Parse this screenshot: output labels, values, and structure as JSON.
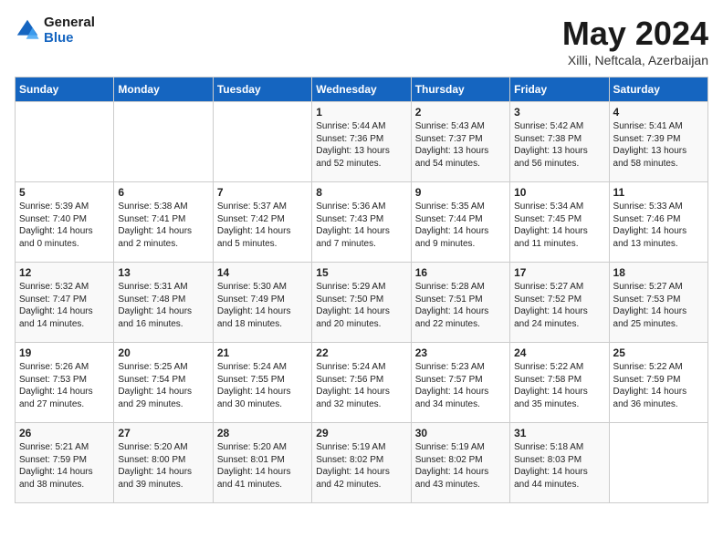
{
  "logo": {
    "line1": "General",
    "line2": "Blue"
  },
  "title": "May 2024",
  "location": "Xilli, Neftcala, Azerbaijan",
  "days_of_week": [
    "Sunday",
    "Monday",
    "Tuesday",
    "Wednesday",
    "Thursday",
    "Friday",
    "Saturday"
  ],
  "weeks": [
    [
      {
        "day": "",
        "detail": ""
      },
      {
        "day": "",
        "detail": ""
      },
      {
        "day": "",
        "detail": ""
      },
      {
        "day": "1",
        "detail": "Sunrise: 5:44 AM\nSunset: 7:36 PM\nDaylight: 13 hours\nand 52 minutes."
      },
      {
        "day": "2",
        "detail": "Sunrise: 5:43 AM\nSunset: 7:37 PM\nDaylight: 13 hours\nand 54 minutes."
      },
      {
        "day": "3",
        "detail": "Sunrise: 5:42 AM\nSunset: 7:38 PM\nDaylight: 13 hours\nand 56 minutes."
      },
      {
        "day": "4",
        "detail": "Sunrise: 5:41 AM\nSunset: 7:39 PM\nDaylight: 13 hours\nand 58 minutes."
      }
    ],
    [
      {
        "day": "5",
        "detail": "Sunrise: 5:39 AM\nSunset: 7:40 PM\nDaylight: 14 hours\nand 0 minutes."
      },
      {
        "day": "6",
        "detail": "Sunrise: 5:38 AM\nSunset: 7:41 PM\nDaylight: 14 hours\nand 2 minutes."
      },
      {
        "day": "7",
        "detail": "Sunrise: 5:37 AM\nSunset: 7:42 PM\nDaylight: 14 hours\nand 5 minutes."
      },
      {
        "day": "8",
        "detail": "Sunrise: 5:36 AM\nSunset: 7:43 PM\nDaylight: 14 hours\nand 7 minutes."
      },
      {
        "day": "9",
        "detail": "Sunrise: 5:35 AM\nSunset: 7:44 PM\nDaylight: 14 hours\nand 9 minutes."
      },
      {
        "day": "10",
        "detail": "Sunrise: 5:34 AM\nSunset: 7:45 PM\nDaylight: 14 hours\nand 11 minutes."
      },
      {
        "day": "11",
        "detail": "Sunrise: 5:33 AM\nSunset: 7:46 PM\nDaylight: 14 hours\nand 13 minutes."
      }
    ],
    [
      {
        "day": "12",
        "detail": "Sunrise: 5:32 AM\nSunset: 7:47 PM\nDaylight: 14 hours\nand 14 minutes."
      },
      {
        "day": "13",
        "detail": "Sunrise: 5:31 AM\nSunset: 7:48 PM\nDaylight: 14 hours\nand 16 minutes."
      },
      {
        "day": "14",
        "detail": "Sunrise: 5:30 AM\nSunset: 7:49 PM\nDaylight: 14 hours\nand 18 minutes."
      },
      {
        "day": "15",
        "detail": "Sunrise: 5:29 AM\nSunset: 7:50 PM\nDaylight: 14 hours\nand 20 minutes."
      },
      {
        "day": "16",
        "detail": "Sunrise: 5:28 AM\nSunset: 7:51 PM\nDaylight: 14 hours\nand 22 minutes."
      },
      {
        "day": "17",
        "detail": "Sunrise: 5:27 AM\nSunset: 7:52 PM\nDaylight: 14 hours\nand 24 minutes."
      },
      {
        "day": "18",
        "detail": "Sunrise: 5:27 AM\nSunset: 7:53 PM\nDaylight: 14 hours\nand 25 minutes."
      }
    ],
    [
      {
        "day": "19",
        "detail": "Sunrise: 5:26 AM\nSunset: 7:53 PM\nDaylight: 14 hours\nand 27 minutes."
      },
      {
        "day": "20",
        "detail": "Sunrise: 5:25 AM\nSunset: 7:54 PM\nDaylight: 14 hours\nand 29 minutes."
      },
      {
        "day": "21",
        "detail": "Sunrise: 5:24 AM\nSunset: 7:55 PM\nDaylight: 14 hours\nand 30 minutes."
      },
      {
        "day": "22",
        "detail": "Sunrise: 5:24 AM\nSunset: 7:56 PM\nDaylight: 14 hours\nand 32 minutes."
      },
      {
        "day": "23",
        "detail": "Sunrise: 5:23 AM\nSunset: 7:57 PM\nDaylight: 14 hours\nand 34 minutes."
      },
      {
        "day": "24",
        "detail": "Sunrise: 5:22 AM\nSunset: 7:58 PM\nDaylight: 14 hours\nand 35 minutes."
      },
      {
        "day": "25",
        "detail": "Sunrise: 5:22 AM\nSunset: 7:59 PM\nDaylight: 14 hours\nand 36 minutes."
      }
    ],
    [
      {
        "day": "26",
        "detail": "Sunrise: 5:21 AM\nSunset: 7:59 PM\nDaylight: 14 hours\nand 38 minutes."
      },
      {
        "day": "27",
        "detail": "Sunrise: 5:20 AM\nSunset: 8:00 PM\nDaylight: 14 hours\nand 39 minutes."
      },
      {
        "day": "28",
        "detail": "Sunrise: 5:20 AM\nSunset: 8:01 PM\nDaylight: 14 hours\nand 41 minutes."
      },
      {
        "day": "29",
        "detail": "Sunrise: 5:19 AM\nSunset: 8:02 PM\nDaylight: 14 hours\nand 42 minutes."
      },
      {
        "day": "30",
        "detail": "Sunrise: 5:19 AM\nSunset: 8:02 PM\nDaylight: 14 hours\nand 43 minutes."
      },
      {
        "day": "31",
        "detail": "Sunrise: 5:18 AM\nSunset: 8:03 PM\nDaylight: 14 hours\nand 44 minutes."
      },
      {
        "day": "",
        "detail": ""
      }
    ]
  ]
}
